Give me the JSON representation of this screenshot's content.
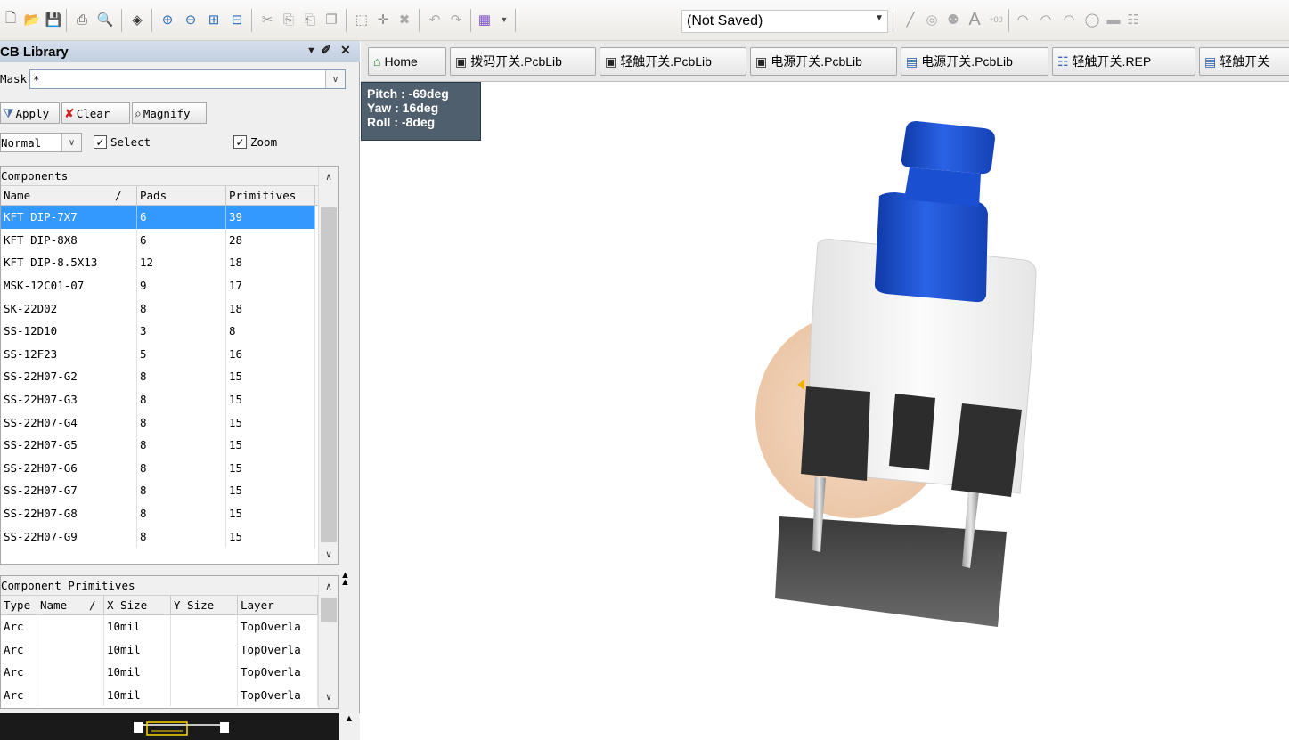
{
  "toolbar": {
    "state_combo": "(Not Saved)"
  },
  "panel": {
    "title": "CB Library",
    "mask_label": "Mask",
    "mask_value": "*",
    "apply_label": "Apply",
    "clear_label": "Clear",
    "magnify_label": "Magnify",
    "mode_value": "Normal",
    "select_label": "Select",
    "zoom_label": "Zoom",
    "select_checked": true,
    "zoom_checked": true
  },
  "components": {
    "caption": "Components",
    "headers": [
      "Name",
      "Pads",
      "Primitives"
    ],
    "sort_marker": "/",
    "rows": [
      [
        "KFT DIP-7X7",
        "6",
        "39"
      ],
      [
        "KFT DIP-8X8",
        "6",
        "28"
      ],
      [
        "KFT DIP-8.5X13",
        "12",
        "18"
      ],
      [
        "MSK-12C01-07",
        "9",
        "17"
      ],
      [
        "SK-22D02",
        "8",
        "18"
      ],
      [
        "SS-12D10",
        "3",
        "8"
      ],
      [
        "SS-12F23",
        "5",
        "16"
      ],
      [
        "SS-22H07-G2",
        "8",
        "15"
      ],
      [
        "SS-22H07-G3",
        "8",
        "15"
      ],
      [
        "SS-22H07-G4",
        "8",
        "15"
      ],
      [
        "SS-22H07-G5",
        "8",
        "15"
      ],
      [
        "SS-22H07-G6",
        "8",
        "15"
      ],
      [
        "SS-22H07-G7",
        "8",
        "15"
      ],
      [
        "SS-22H07-G8",
        "8",
        "15"
      ],
      [
        "SS-22H07-G9",
        "8",
        "15"
      ]
    ],
    "selected_index": 0
  },
  "primitives": {
    "caption": "Component Primitives",
    "headers": [
      "Type",
      "Name",
      "X-Size",
      "Y-Size",
      "Layer"
    ],
    "sort_marker": "/",
    "rows": [
      [
        "Arc",
        "",
        "10mil",
        "",
        "TopOverla"
      ],
      [
        "Arc",
        "",
        "10mil",
        "",
        "TopOverla"
      ],
      [
        "Arc",
        "",
        "10mil",
        "",
        "TopOverla"
      ],
      [
        "Arc",
        "",
        "10mil",
        "",
        "TopOverla"
      ]
    ]
  },
  "tabs": [
    {
      "label": "Home",
      "icon": "home-icon"
    },
    {
      "label": "拨码开关.PcbLib",
      "icon": "pcblib-icon"
    },
    {
      "label": "轻触开关.PcbLib",
      "icon": "pcblib-icon"
    },
    {
      "label": "电源开关.PcbLib",
      "icon": "pcblib-icon"
    },
    {
      "label": "电源开关.PcbLib",
      "icon": "pcbdoc-icon"
    },
    {
      "label": "轻触开关.REP",
      "icon": "report-icon"
    },
    {
      "label": "轻触开关",
      "icon": "pcbdoc-icon"
    }
  ],
  "viewport": {
    "hud_pitch": "Pitch : -69deg",
    "hud_yaw": "Yaw : 16deg",
    "hud_roll": "Roll : -8deg"
  },
  "colors": {
    "selection": "#3399ff",
    "hud_bg": "#4f5f6d",
    "actuator_blue": "#1a4fd1",
    "body_white": "#f4f4f4",
    "pad_dark": "#2f2f2f",
    "footprint_peach": "#f2d2b6"
  }
}
